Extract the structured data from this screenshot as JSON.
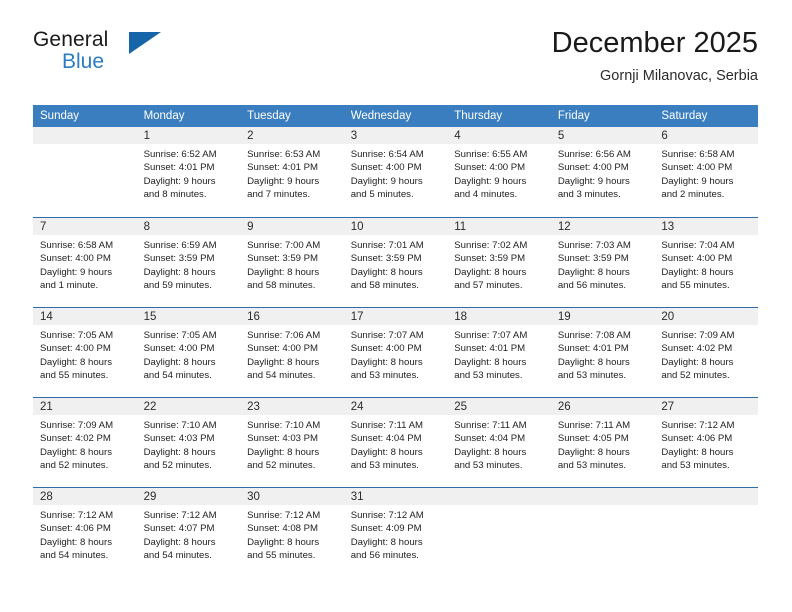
{
  "brand": {
    "name_top": "General",
    "name_bottom": "Blue",
    "accent_color": "#2b7cc4",
    "triangle_color": "#1565a8"
  },
  "header": {
    "title": "December 2025",
    "subtitle": "Gornji Milanovac, Serbia"
  },
  "theme": {
    "header_bg": "#3a7ebf",
    "daynum_bg": "#f0f0f0",
    "row_divider": "#2f6ca8",
    "text": "#1f1f1f"
  },
  "weekdays": [
    "Sunday",
    "Monday",
    "Tuesday",
    "Wednesday",
    "Thursday",
    "Friday",
    "Saturday"
  ],
  "labels": {
    "sunrise_prefix": "Sunrise:",
    "sunset_prefix": "Sunset:",
    "daylight_prefix": "Daylight:"
  },
  "weeks": [
    [
      {
        "day": "",
        "empty": true,
        "l1": "",
        "l2": "",
        "l3": "",
        "l4": ""
      },
      {
        "day": "1",
        "l1": "Sunrise: 6:52 AM",
        "l2": "Sunset: 4:01 PM",
        "l3": "Daylight: 9 hours",
        "l4": "and 8 minutes."
      },
      {
        "day": "2",
        "l1": "Sunrise: 6:53 AM",
        "l2": "Sunset: 4:01 PM",
        "l3": "Daylight: 9 hours",
        "l4": "and 7 minutes."
      },
      {
        "day": "3",
        "l1": "Sunrise: 6:54 AM",
        "l2": "Sunset: 4:00 PM",
        "l3": "Daylight: 9 hours",
        "l4": "and 5 minutes."
      },
      {
        "day": "4",
        "l1": "Sunrise: 6:55 AM",
        "l2": "Sunset: 4:00 PM",
        "l3": "Daylight: 9 hours",
        "l4": "and 4 minutes."
      },
      {
        "day": "5",
        "l1": "Sunrise: 6:56 AM",
        "l2": "Sunset: 4:00 PM",
        "l3": "Daylight: 9 hours",
        "l4": "and 3 minutes."
      },
      {
        "day": "6",
        "l1": "Sunrise: 6:58 AM",
        "l2": "Sunset: 4:00 PM",
        "l3": "Daylight: 9 hours",
        "l4": "and 2 minutes."
      }
    ],
    [
      {
        "day": "7",
        "l1": "Sunrise: 6:58 AM",
        "l2": "Sunset: 4:00 PM",
        "l3": "Daylight: 9 hours",
        "l4": "and 1 minute."
      },
      {
        "day": "8",
        "l1": "Sunrise: 6:59 AM",
        "l2": "Sunset: 3:59 PM",
        "l3": "Daylight: 8 hours",
        "l4": "and 59 minutes."
      },
      {
        "day": "9",
        "l1": "Sunrise: 7:00 AM",
        "l2": "Sunset: 3:59 PM",
        "l3": "Daylight: 8 hours",
        "l4": "and 58 minutes."
      },
      {
        "day": "10",
        "l1": "Sunrise: 7:01 AM",
        "l2": "Sunset: 3:59 PM",
        "l3": "Daylight: 8 hours",
        "l4": "and 58 minutes."
      },
      {
        "day": "11",
        "l1": "Sunrise: 7:02 AM",
        "l2": "Sunset: 3:59 PM",
        "l3": "Daylight: 8 hours",
        "l4": "and 57 minutes."
      },
      {
        "day": "12",
        "l1": "Sunrise: 7:03 AM",
        "l2": "Sunset: 3:59 PM",
        "l3": "Daylight: 8 hours",
        "l4": "and 56 minutes."
      },
      {
        "day": "13",
        "l1": "Sunrise: 7:04 AM",
        "l2": "Sunset: 4:00 PM",
        "l3": "Daylight: 8 hours",
        "l4": "and 55 minutes."
      }
    ],
    [
      {
        "day": "14",
        "l1": "Sunrise: 7:05 AM",
        "l2": "Sunset: 4:00 PM",
        "l3": "Daylight: 8 hours",
        "l4": "and 55 minutes."
      },
      {
        "day": "15",
        "l1": "Sunrise: 7:05 AM",
        "l2": "Sunset: 4:00 PM",
        "l3": "Daylight: 8 hours",
        "l4": "and 54 minutes."
      },
      {
        "day": "16",
        "l1": "Sunrise: 7:06 AM",
        "l2": "Sunset: 4:00 PM",
        "l3": "Daylight: 8 hours",
        "l4": "and 54 minutes."
      },
      {
        "day": "17",
        "l1": "Sunrise: 7:07 AM",
        "l2": "Sunset: 4:00 PM",
        "l3": "Daylight: 8 hours",
        "l4": "and 53 minutes."
      },
      {
        "day": "18",
        "l1": "Sunrise: 7:07 AM",
        "l2": "Sunset: 4:01 PM",
        "l3": "Daylight: 8 hours",
        "l4": "and 53 minutes."
      },
      {
        "day": "19",
        "l1": "Sunrise: 7:08 AM",
        "l2": "Sunset: 4:01 PM",
        "l3": "Daylight: 8 hours",
        "l4": "and 53 minutes."
      },
      {
        "day": "20",
        "l1": "Sunrise: 7:09 AM",
        "l2": "Sunset: 4:02 PM",
        "l3": "Daylight: 8 hours",
        "l4": "and 52 minutes."
      }
    ],
    [
      {
        "day": "21",
        "l1": "Sunrise: 7:09 AM",
        "l2": "Sunset: 4:02 PM",
        "l3": "Daylight: 8 hours",
        "l4": "and 52 minutes."
      },
      {
        "day": "22",
        "l1": "Sunrise: 7:10 AM",
        "l2": "Sunset: 4:03 PM",
        "l3": "Daylight: 8 hours",
        "l4": "and 52 minutes."
      },
      {
        "day": "23",
        "l1": "Sunrise: 7:10 AM",
        "l2": "Sunset: 4:03 PM",
        "l3": "Daylight: 8 hours",
        "l4": "and 52 minutes."
      },
      {
        "day": "24",
        "l1": "Sunrise: 7:11 AM",
        "l2": "Sunset: 4:04 PM",
        "l3": "Daylight: 8 hours",
        "l4": "and 53 minutes."
      },
      {
        "day": "25",
        "l1": "Sunrise: 7:11 AM",
        "l2": "Sunset: 4:04 PM",
        "l3": "Daylight: 8 hours",
        "l4": "and 53 minutes."
      },
      {
        "day": "26",
        "l1": "Sunrise: 7:11 AM",
        "l2": "Sunset: 4:05 PM",
        "l3": "Daylight: 8 hours",
        "l4": "and 53 minutes."
      },
      {
        "day": "27",
        "l1": "Sunrise: 7:12 AM",
        "l2": "Sunset: 4:06 PM",
        "l3": "Daylight: 8 hours",
        "l4": "and 53 minutes."
      }
    ],
    [
      {
        "day": "28",
        "l1": "Sunrise: 7:12 AM",
        "l2": "Sunset: 4:06 PM",
        "l3": "Daylight: 8 hours",
        "l4": "and 54 minutes."
      },
      {
        "day": "29",
        "l1": "Sunrise: 7:12 AM",
        "l2": "Sunset: 4:07 PM",
        "l3": "Daylight: 8 hours",
        "l4": "and 54 minutes."
      },
      {
        "day": "30",
        "l1": "Sunrise: 7:12 AM",
        "l2": "Sunset: 4:08 PM",
        "l3": "Daylight: 8 hours",
        "l4": "and 55 minutes."
      },
      {
        "day": "31",
        "l1": "Sunrise: 7:12 AM",
        "l2": "Sunset: 4:09 PM",
        "l3": "Daylight: 8 hours",
        "l4": "and 56 minutes."
      },
      {
        "day": "",
        "empty": true,
        "l1": "",
        "l2": "",
        "l3": "",
        "l4": ""
      },
      {
        "day": "",
        "empty": true,
        "l1": "",
        "l2": "",
        "l3": "",
        "l4": ""
      },
      {
        "day": "",
        "empty": true,
        "l1": "",
        "l2": "",
        "l3": "",
        "l4": ""
      }
    ]
  ]
}
